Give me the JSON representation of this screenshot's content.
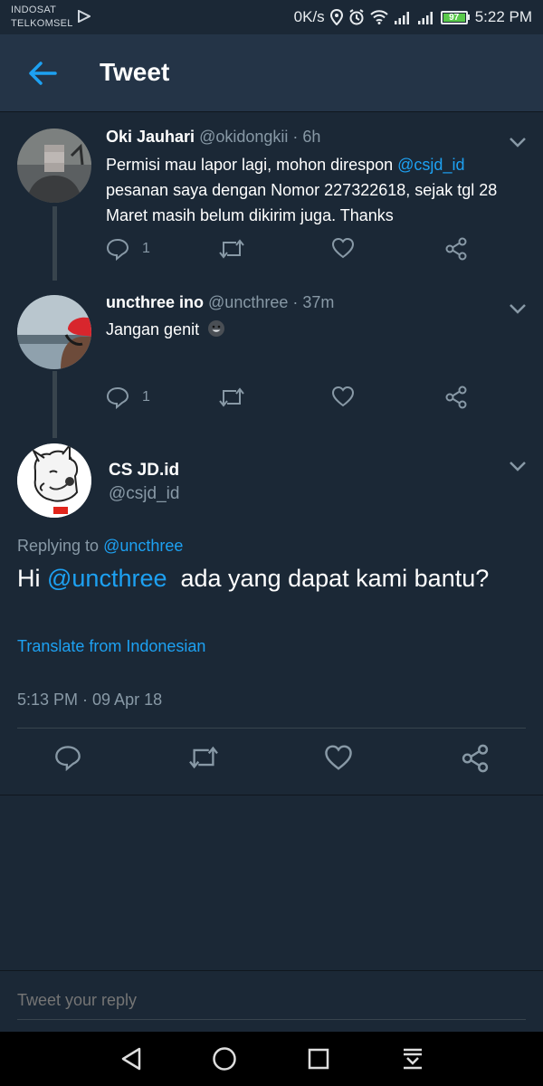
{
  "status_bar": {
    "carrier1": "INDOSAT",
    "carrier2": "TELKOMSEL",
    "speed": "0K/s",
    "battery": "97",
    "time": "5:22 PM"
  },
  "header": {
    "title": "Tweet"
  },
  "tweets": [
    {
      "name": "Oki Jauhari",
      "handle": "@okidongkii",
      "time": " · 6h",
      "text_parts": [
        "Permisi mau lapor lagi, mohon direspon ",
        "@csjd_id",
        " pesanan saya dengan Nomor 227322618, sejak tgl 28 Maret masih belum dikirim juga. Thanks"
      ],
      "reply_count": "1"
    },
    {
      "name": "uncthree ino",
      "handle": "@uncthree",
      "time": " · 37m",
      "text": "Jangan genit",
      "reply_count": "1"
    }
  ],
  "main_tweet": {
    "name": "CS JD.id",
    "handle": "@csjd_id",
    "replying_label": "Replying to ",
    "replying_handle": "@uncthree",
    "text_greeting": "Hi ",
    "text_mention": "@uncthree",
    "text_body": "  ada yang dapat kami bantu?",
    "translate": "Translate from Indonesian",
    "timestamp": "5:13 PM · 09 Apr 18"
  },
  "reply": {
    "placeholder": "Tweet your reply"
  },
  "icons": {
    "back": "arrow-left-icon",
    "reply": "reply-icon",
    "retweet": "retweet-icon",
    "like": "heart-icon",
    "share": "share-icon",
    "more": "chevron-down-icon"
  },
  "colors": {
    "background": "#1b2836",
    "header": "#243447",
    "accent": "#1da1f2",
    "muted": "#8899a6",
    "battery": "#59c94b"
  }
}
